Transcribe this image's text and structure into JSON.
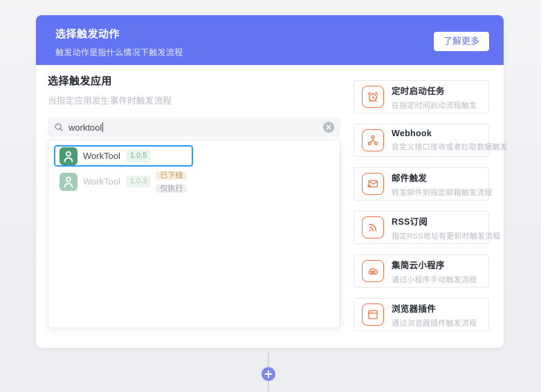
{
  "header": {
    "title": "选择触发动作",
    "subtitle": "触发动作是指什么情况下触发流程",
    "learn_more_label": "了解更多"
  },
  "left_panel": {
    "title": "选择触发应用",
    "subtitle": "当指定应用发生事件时触发流程",
    "search": {
      "value": "worktool",
      "icon": "search-icon",
      "clear_icon": "clear-icon"
    },
    "results": [
      {
        "name": "WorkTool",
        "version": "1.0.5",
        "selected": true,
        "icon": "worktool-app-icon",
        "badges": []
      },
      {
        "name": "WorkTool",
        "version": "1.0.3",
        "selected": false,
        "icon": "worktool-app-icon",
        "badges": [
          {
            "label": "已下线",
            "kind": "warning"
          },
          {
            "label": "仅执行",
            "kind": "default"
          }
        ]
      }
    ]
  },
  "builtin_triggers": [
    {
      "icon": "alarm-clock-icon",
      "title": "定时启动任务",
      "desc": "在指定时间启动流程触发"
    },
    {
      "icon": "webhook-icon",
      "title": "Webhook",
      "desc": "自定义接口接收或者拉取数据触发"
    },
    {
      "icon": "mail-forward-icon",
      "title": "邮件触发",
      "desc": "转发邮件到指定邮箱触发流程"
    },
    {
      "icon": "rss-icon",
      "title": "RSS订阅",
      "desc": "指定RSS地址有更新时触发流程"
    },
    {
      "icon": "cloud-miniapp-icon",
      "title": "集简云小程序",
      "desc": "通过小程序手动触发流程"
    },
    {
      "icon": "browser-plugin-icon",
      "title": "浏览器插件",
      "desc": "通过浏览器插件触发流程"
    }
  ],
  "flow": {
    "add_node_icon": "plus-icon"
  },
  "colors": {
    "accent_purple": "#6274f1",
    "trigger_orange": "#ed7140",
    "worktool_green": "#4a9b74",
    "selection_blue": "#2a9bf4",
    "connector_gray": "#d5d7db",
    "plus_node_purple": "#7d87ea"
  }
}
